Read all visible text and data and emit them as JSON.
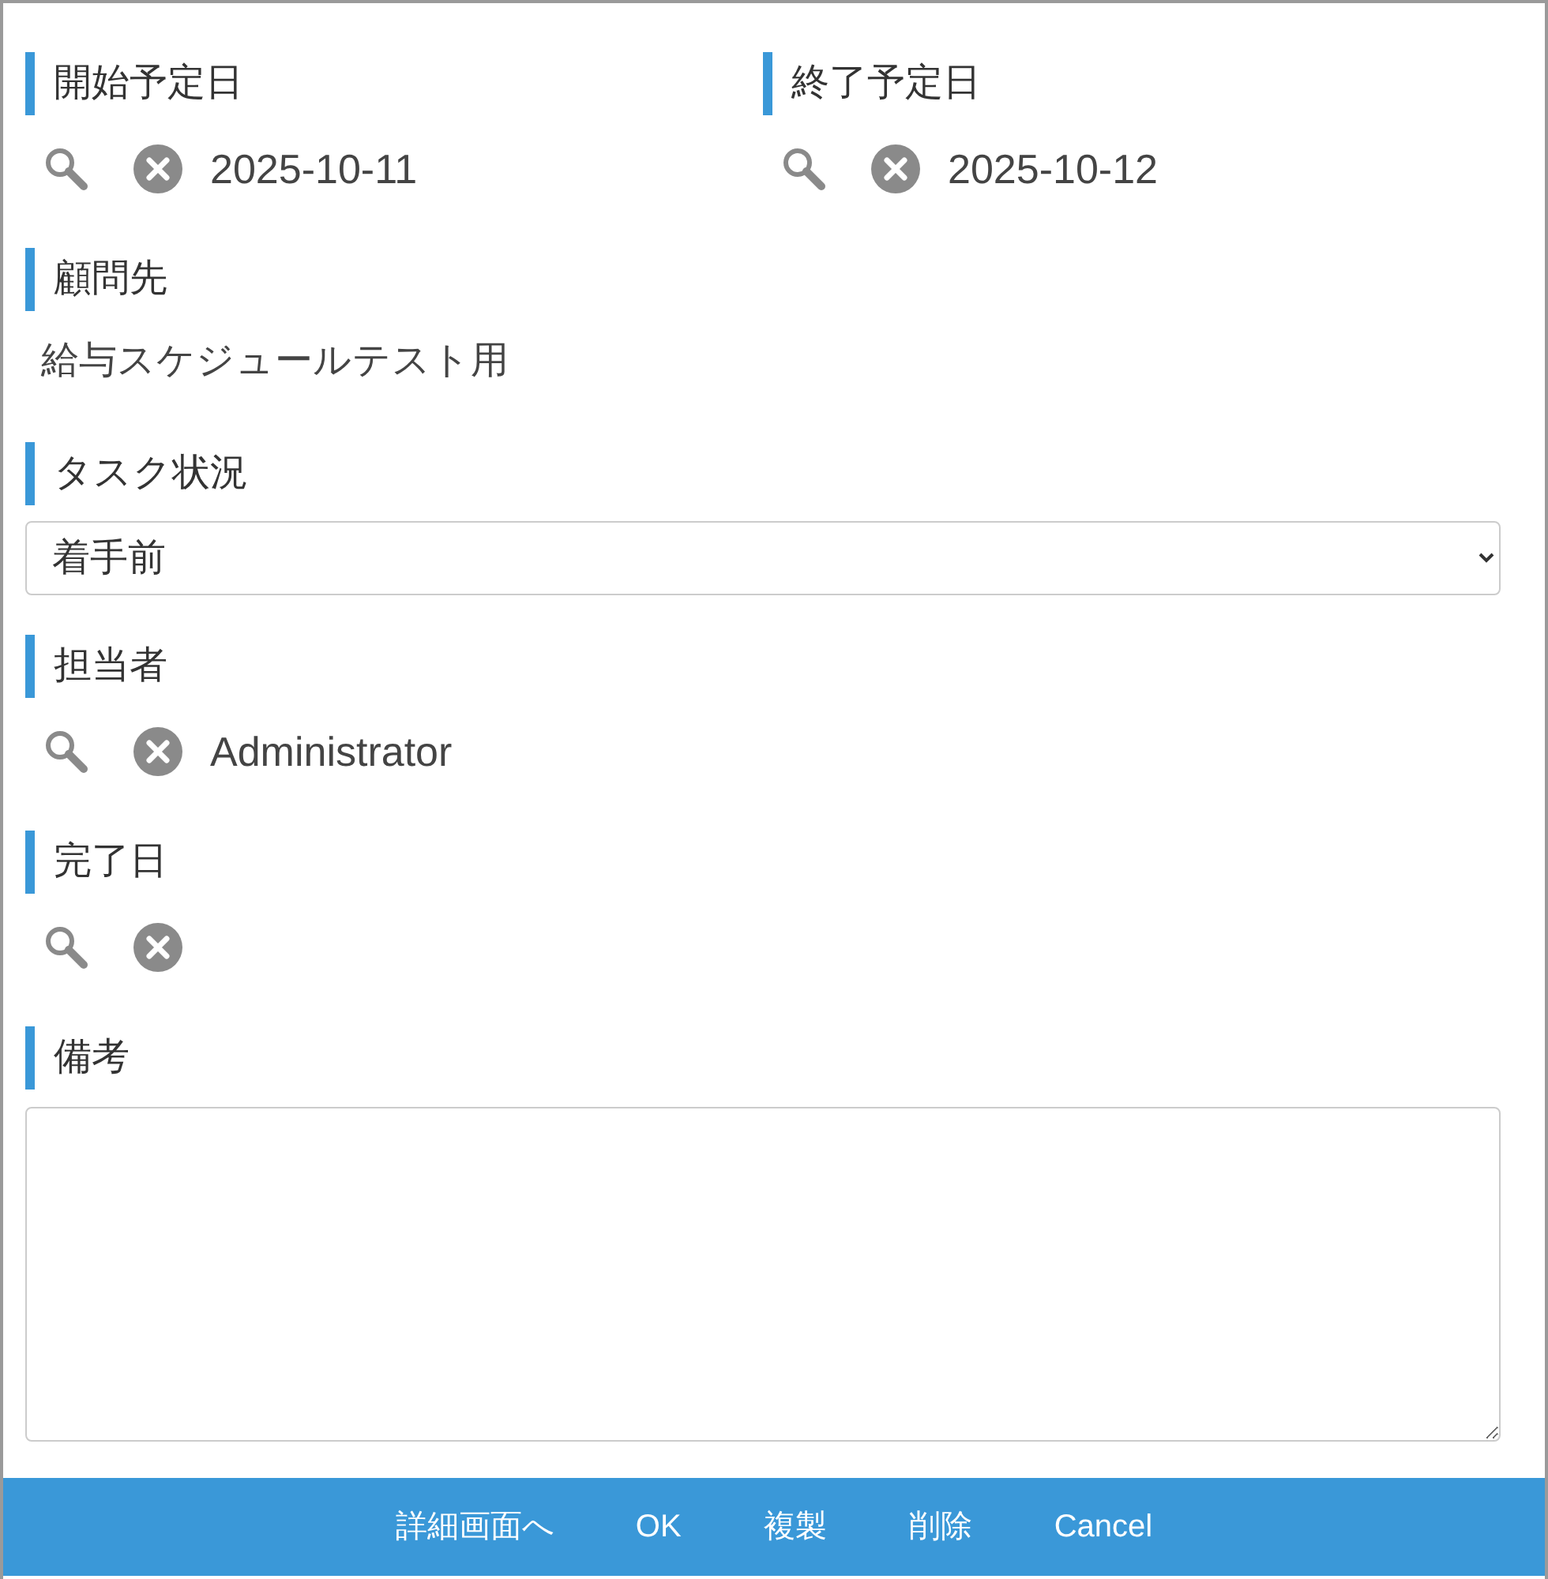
{
  "rows": [
    [
      {
        "kind": "lookup",
        "label": "開始予定日",
        "value": "2025-10-11"
      },
      {
        "kind": "lookup",
        "label": "終了予定日",
        "value": "2025-10-12"
      }
    ],
    [
      {
        "kind": "text",
        "label": "顧問先",
        "value": "給与スケジュールテスト用"
      }
    ],
    [
      {
        "kind": "select",
        "label": "タスク状況",
        "value": "着手前"
      }
    ],
    [
      {
        "kind": "lookup",
        "label": "担当者",
        "value": "Administrator"
      }
    ],
    [
      {
        "kind": "lookup",
        "label": "完了日"
      }
    ],
    [
      {
        "kind": "textarea",
        "label": "備考"
      }
    ]
  ],
  "footer_buttons": [
    "詳細画面へ",
    "OK",
    "複製",
    "削除",
    "Cancel"
  ]
}
